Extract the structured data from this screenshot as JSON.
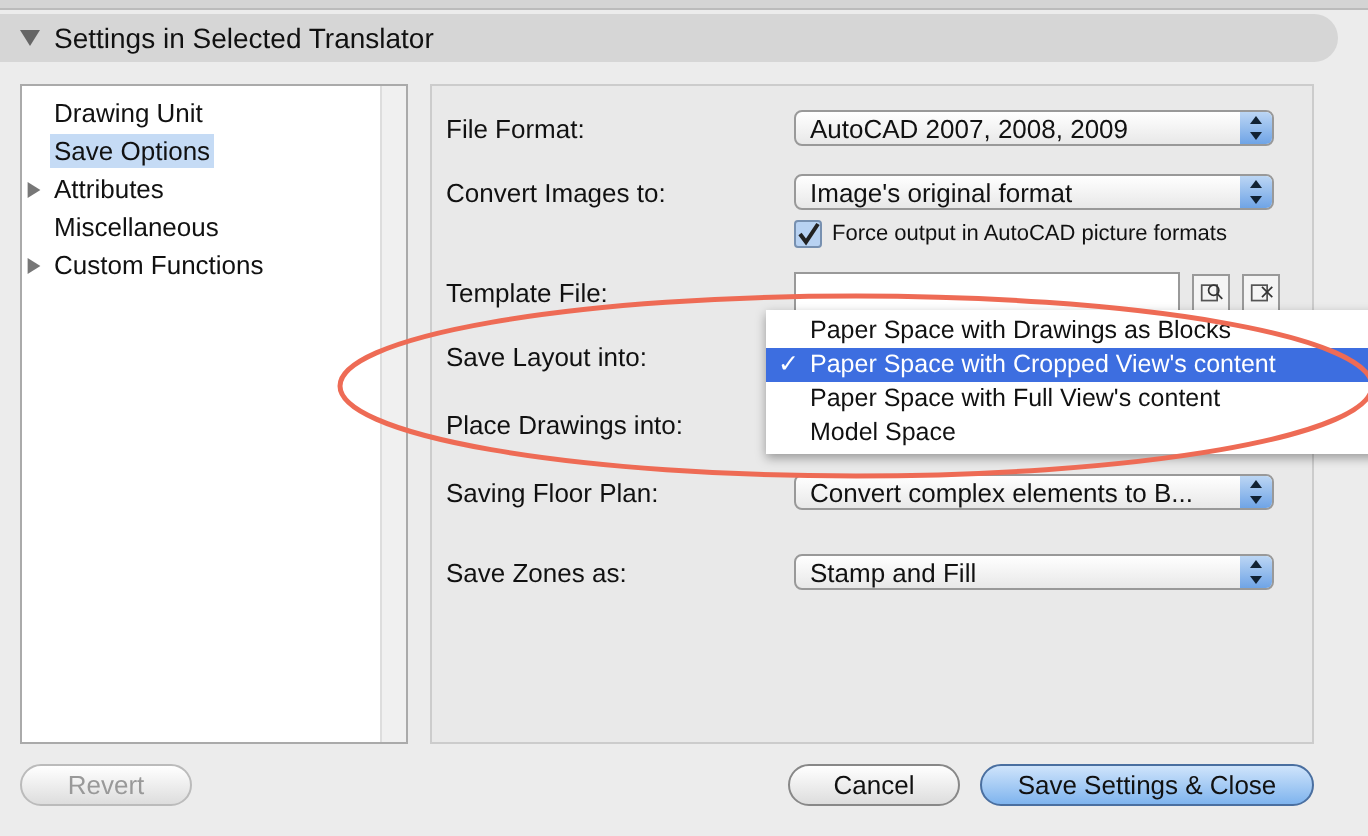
{
  "section": {
    "title": "Settings in Selected Translator",
    "expanded": true
  },
  "sidebar": {
    "items": [
      {
        "label": "Drawing Unit",
        "selected": false,
        "expandable": false
      },
      {
        "label": "Save Options",
        "selected": true,
        "expandable": false
      },
      {
        "label": "Attributes",
        "selected": false,
        "expandable": true
      },
      {
        "label": "Miscellaneous",
        "selected": false,
        "expandable": false
      },
      {
        "label": "Custom Functions",
        "selected": false,
        "expandable": true
      }
    ]
  },
  "form": {
    "rows": [
      {
        "kind": "select",
        "label": "File Format:",
        "value": "AutoCAD 2007, 2008, 2009"
      },
      {
        "kind": "select",
        "label": "Convert Images to:",
        "value": "Image's original format"
      },
      {
        "kind": "checkbox",
        "label": "Force output in AutoCAD picture formats",
        "checked": true
      },
      {
        "kind": "file",
        "label": "Template File:",
        "value": ""
      },
      {
        "kind": "menu",
        "label": "Save Layout into:"
      },
      {
        "kind": "covered",
        "label": "Place Drawings into:"
      },
      {
        "kind": "select",
        "label": "Saving Floor Plan:",
        "value": "Convert complex elements to B..."
      },
      {
        "kind": "select",
        "label": "Save Zones as:",
        "value": "Stamp and Fill"
      }
    ]
  },
  "popup_menu": {
    "check_mark": "✓",
    "items": [
      {
        "label": "Paper Space with Drawings as Blocks",
        "selected": false
      },
      {
        "label": "Paper Space with Cropped View's content",
        "selected": true
      },
      {
        "label": "Paper Space with Full View's content",
        "selected": false
      },
      {
        "label": "Model Space",
        "selected": false
      }
    ]
  },
  "buttons": [
    {
      "label": "Revert",
      "kind": "disabled"
    },
    {
      "label": "Cancel",
      "kind": "normal"
    },
    {
      "label": "Save Settings & Close",
      "kind": "default"
    }
  ]
}
